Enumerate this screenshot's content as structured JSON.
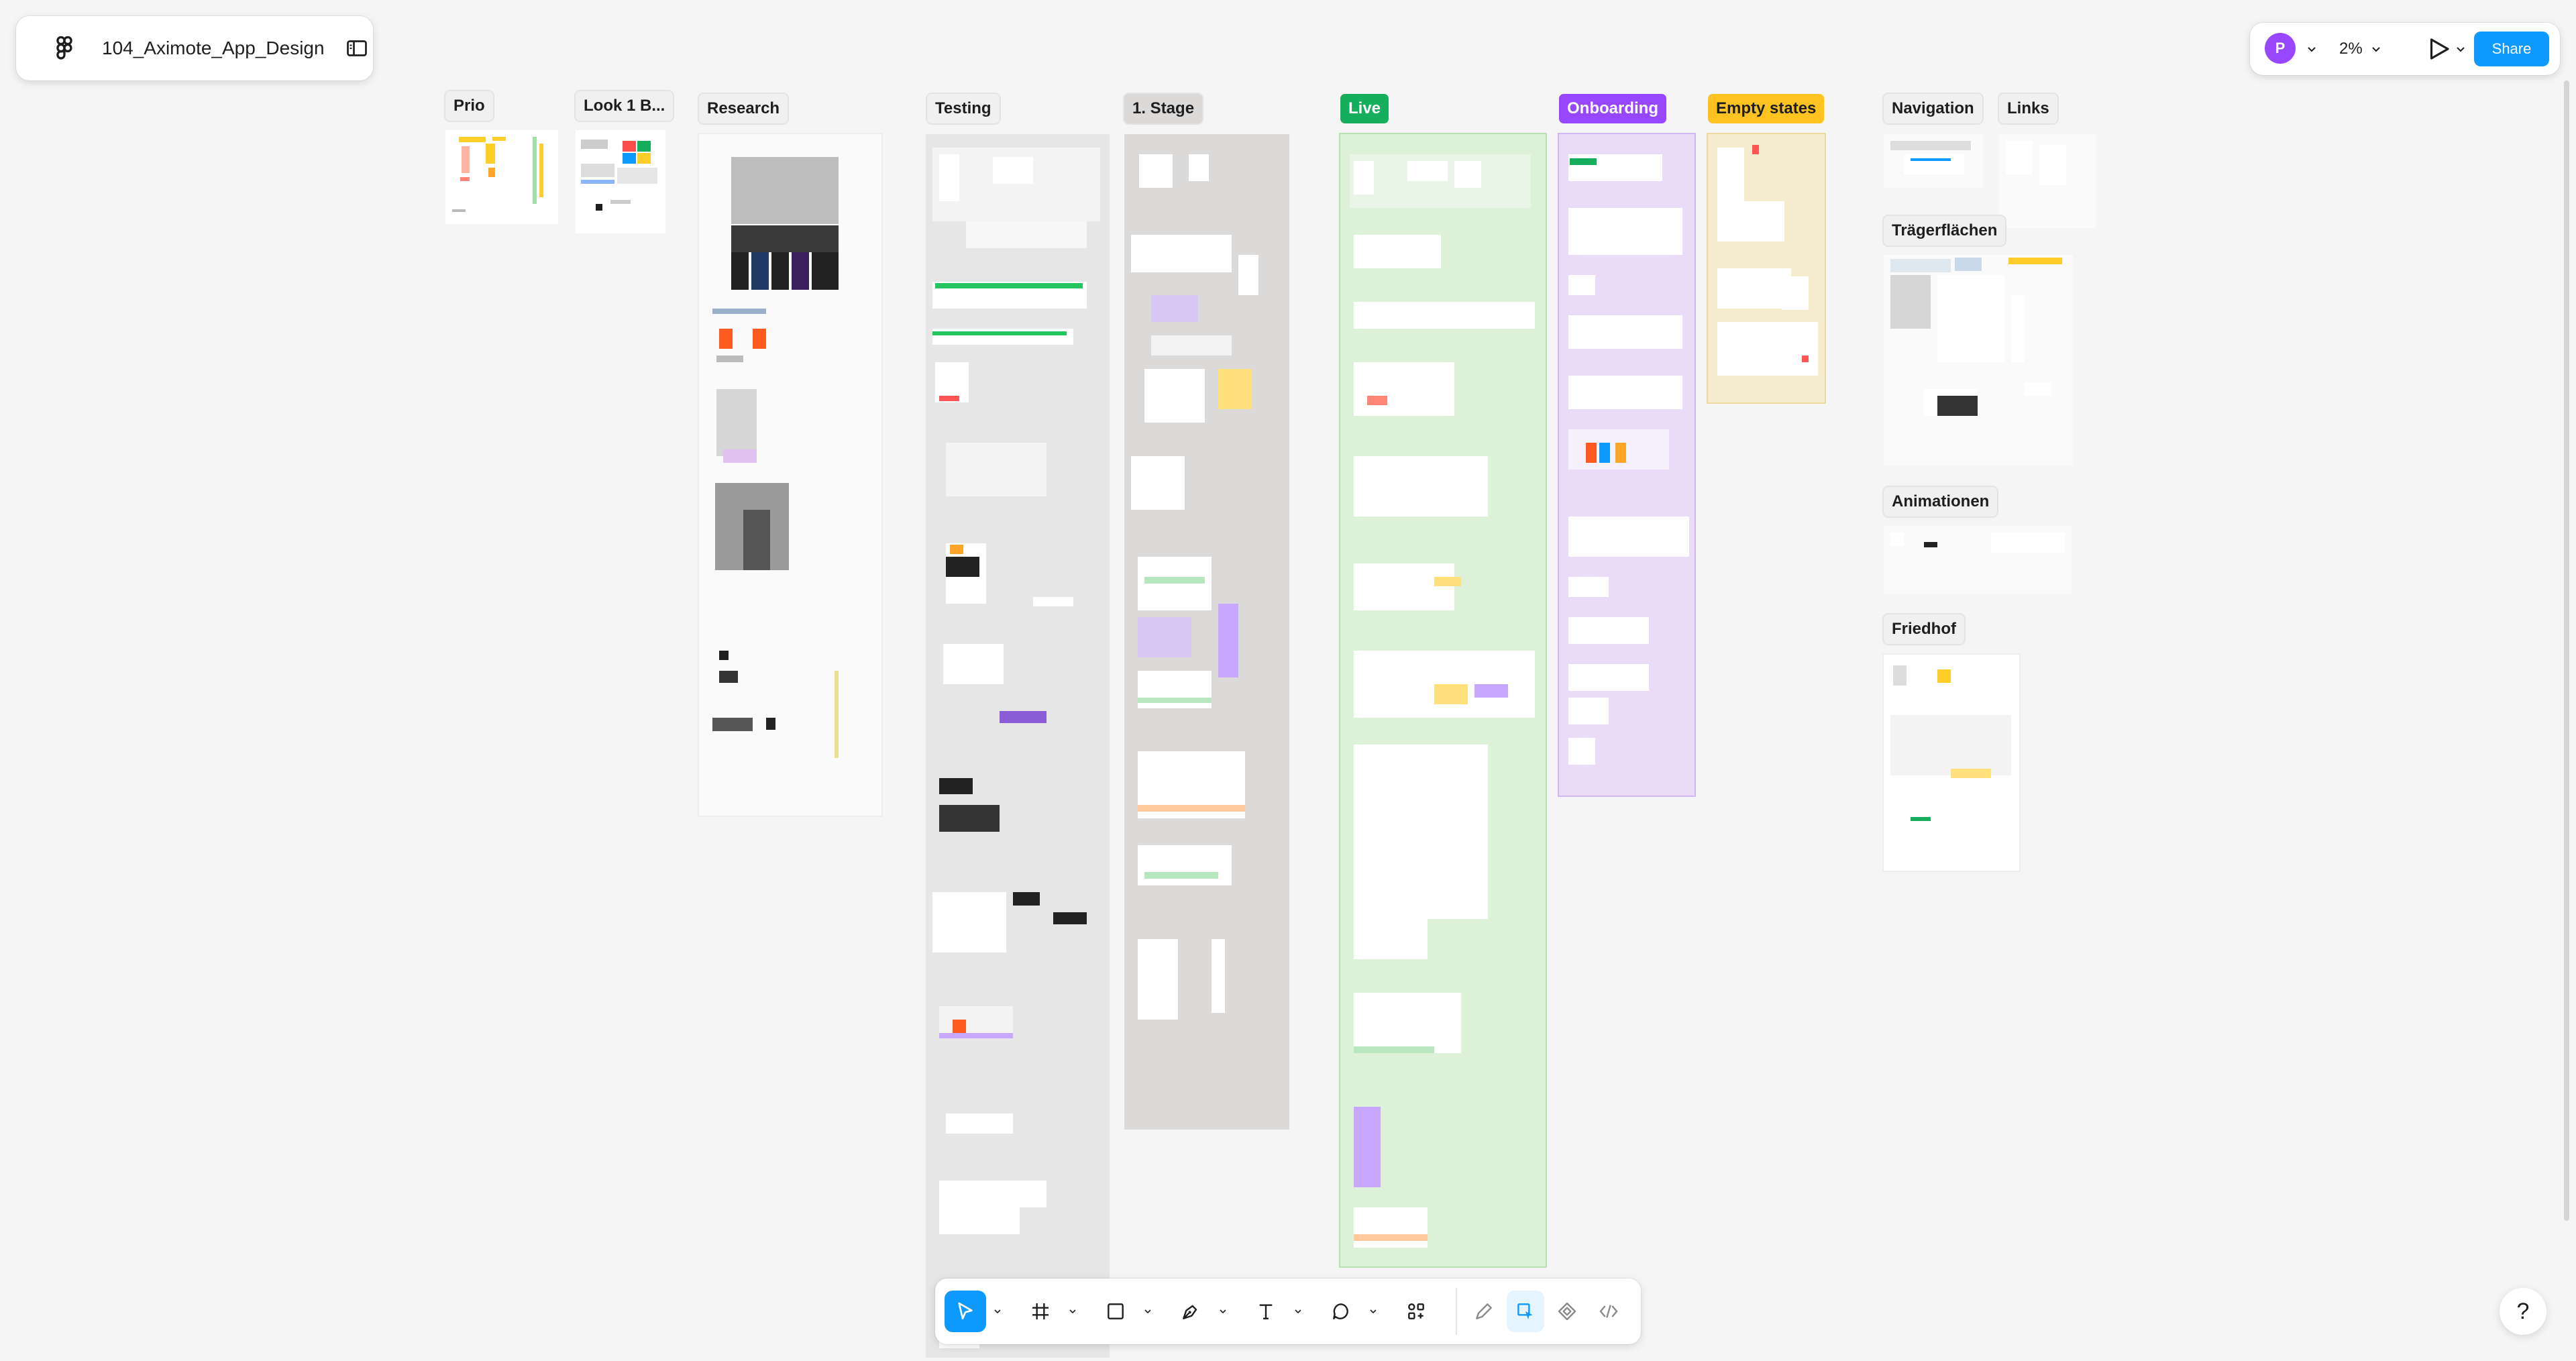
{
  "file": {
    "name": "104_Aximote_App_Design"
  },
  "header": {
    "user_initial": "P",
    "zoom": "2%",
    "share_label": "Share"
  },
  "sections": {
    "prio": "Prio",
    "look": "Look 1 B...",
    "research": "Research",
    "testing": "Testing",
    "stage1": "1. Stage",
    "live": "Live",
    "onboarding": "Onboarding",
    "empty_states": "Empty states",
    "navigation": "Navigation",
    "links": "Links",
    "traegerflaechen": "Trägerflächen",
    "animationen": "Animationen",
    "friedhof": "Friedhof"
  },
  "colors": {
    "accent": "#0d99ff",
    "live_bg": "#ddf0d8",
    "live_label": "#14ae5c",
    "onboarding_bg": "#eadcf7",
    "onboarding_label": "#9747ff",
    "empty_bg": "#f6edd1",
    "empty_label": "#ffc321",
    "stage_bg": "#dcd9d9",
    "testing_bg": "#e6e6e6"
  },
  "toolbar": {
    "tools": [
      "move-tool",
      "frame-tool",
      "shape-tool",
      "pen-tool",
      "text-tool",
      "comment-tool",
      "actions-tool",
      "draw-mode",
      "design-mode",
      "prototype-mode",
      "dev-mode"
    ],
    "active": "move-tool"
  },
  "help": "?"
}
